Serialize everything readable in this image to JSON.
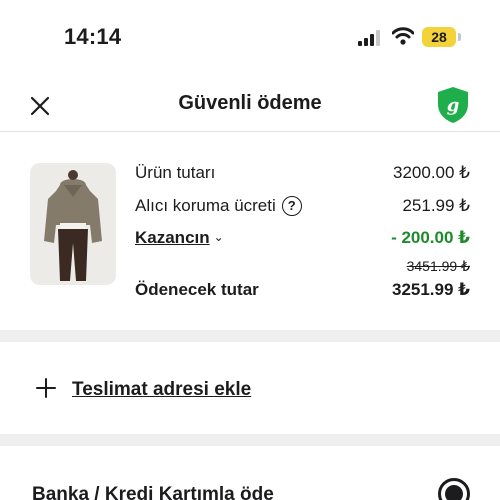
{
  "status_bar": {
    "time": "14:14",
    "battery": "28"
  },
  "header": {
    "title": "Güvenli ödeme",
    "logo_letter": "g"
  },
  "summary": {
    "product_price_label": "Ürün tutarı",
    "product_price_value": "3200.00 ₺",
    "protection_fee_label": "Alıcı koruma ücreti",
    "protection_fee_help": "?",
    "protection_fee_value": "251.99 ₺",
    "earnings_label": "Kazancın",
    "earnings_value": "- 200.00 ₺",
    "original_total": "3451.99 ₺",
    "payable_label": "Ödenecek tutar",
    "payable_value": "3251.99 ₺"
  },
  "address": {
    "add_label": "Teslimat adresi ekle"
  },
  "payment": {
    "option_label": "Banka / Kredi Kartımla öde",
    "selected": true
  },
  "colors": {
    "accent_green": "#1f8a2c",
    "logo_green": "#1fae4b",
    "battery": "#f4d33a"
  }
}
